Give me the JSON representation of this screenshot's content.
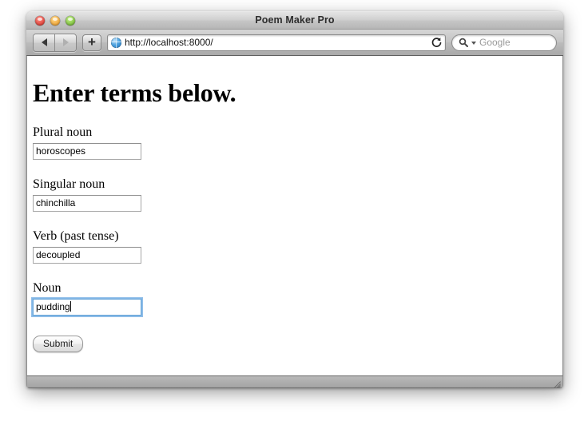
{
  "window": {
    "title": "Poem Maker Pro",
    "traffic_lights": [
      "close",
      "minimize",
      "zoom"
    ]
  },
  "toolbar": {
    "back_label": "Back",
    "forward_label": "Forward",
    "add_label": "+",
    "url": "http://localhost:8000/",
    "favicon": "globe-icon",
    "reload_label": "Reload",
    "search_placeholder": "Google"
  },
  "page": {
    "heading": "Enter terms below.",
    "fields": [
      {
        "label": "Plural noun",
        "value": "horoscopes",
        "focused": false
      },
      {
        "label": "Singular noun",
        "value": "chinchilla",
        "focused": false
      },
      {
        "label": "Verb (past tense)",
        "value": "decoupled",
        "focused": false
      },
      {
        "label": "Noun",
        "value": "pudding",
        "focused": true
      }
    ],
    "submit_label": "Submit"
  },
  "statusbar": {
    "text": ""
  },
  "colors": {
    "focus_ring": "#6eaae1",
    "titlebar_text": "#2d2d2d",
    "page_background": "#ffffff"
  }
}
